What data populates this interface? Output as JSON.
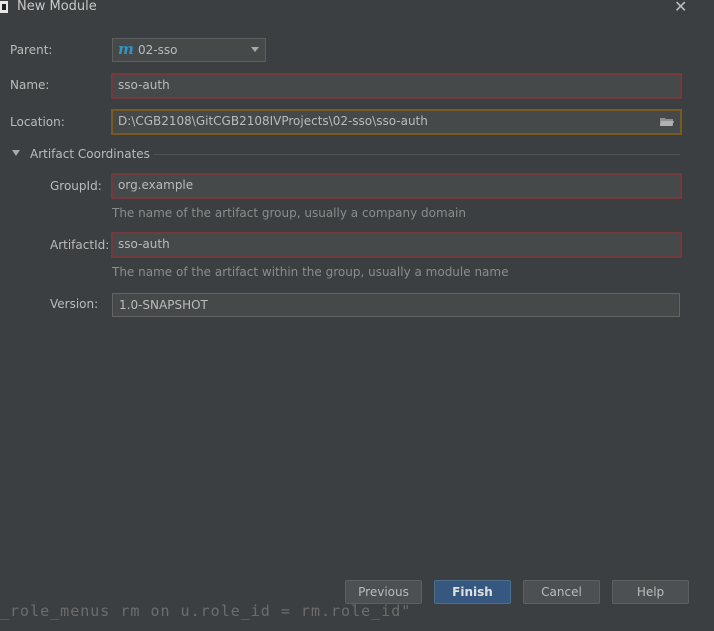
{
  "window": {
    "title": "New Module"
  },
  "form": {
    "parent": {
      "label": "Parent:",
      "value": "02-sso"
    },
    "name": {
      "label": "Name:",
      "value": "sso-auth"
    },
    "location": {
      "label": "Location:",
      "value": "D:\\CGB2108\\GitCGB2108IVProjects\\02-sso\\sso-auth"
    }
  },
  "artifact": {
    "section_title": "Artifact Coordinates",
    "group_id": {
      "label": "GroupId:",
      "value": "org.example",
      "hint": "The name of the artifact group, usually a company domain"
    },
    "artifact_id": {
      "label": "ArtifactId:",
      "value": "sso-auth",
      "hint": "The name of the artifact within the group, usually a module name"
    },
    "version": {
      "label": "Version:",
      "value": "1.0-SNAPSHOT"
    }
  },
  "buttons": {
    "previous": "Previous",
    "finish": "Finish",
    "cancel": "Cancel",
    "help": "Help"
  },
  "background_text": "_role_menus rm on u.role_id = rm.role_id\"",
  "colors": {
    "accent": "#365880",
    "error_border": "#73393b",
    "warning_border": "#7a5a20",
    "module_icon": "#3592c4"
  },
  "icons": {
    "module": "maven-module-icon",
    "browse": "folder-icon",
    "close": "close-icon",
    "dropdown": "chevron-down-icon",
    "section": "collapse-arrow-icon"
  }
}
